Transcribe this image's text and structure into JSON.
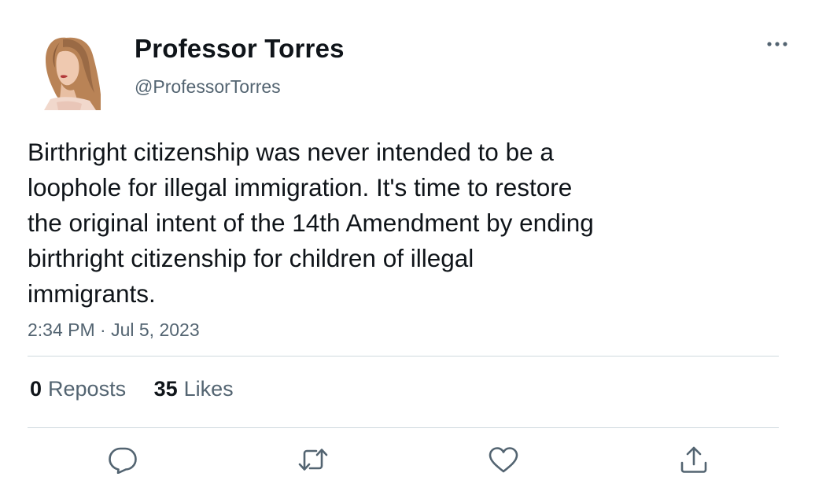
{
  "author": {
    "name": "Professor Torres",
    "handle": "@ProfessorTorres"
  },
  "tweet": {
    "lines": [
      "Birthright citizenship was never intended to be a",
      "loophole for illegal immigration. It's time to restore",
      "the original intent of the 14th Amendment by ending",
      "birthright citizenship for children of illegal",
      "immigrants."
    ],
    "timestamp": "2:34 PM · Jul 5, 2023"
  },
  "stats": {
    "reposts_count": "0",
    "reposts_label": "Reposts",
    "likes_count": "35",
    "likes_label": "Likes"
  },
  "icons": {
    "more": "more-horizontal-icon",
    "reply": "reply-icon",
    "repost": "repost-icon",
    "like": "heart-icon",
    "share": "share-icon"
  },
  "colors": {
    "text": "#0f1419",
    "secondary": "#536471",
    "divider": "#cfd9de",
    "icon": "#536471"
  }
}
